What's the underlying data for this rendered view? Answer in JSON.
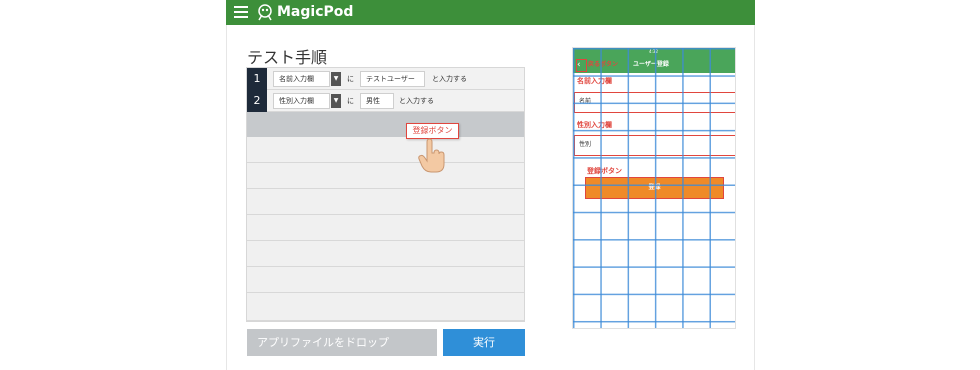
{
  "app": {
    "name": "MagicPod",
    "colors": {
      "header": "#3d8f3a",
      "accent": "#2f8fd8",
      "highlight": "#e0463e",
      "phone_button": "#ef8a28"
    }
  },
  "editor": {
    "title": "テスト手順",
    "steps": [
      {
        "num": "1",
        "element": "名前入力欄",
        "particle": "に",
        "value": "テストユーザー",
        "action": "と入力する"
      },
      {
        "num": "2",
        "element": "性別入力欄",
        "particle": "に",
        "value": "男性",
        "action": "と入力する"
      }
    ],
    "drag_label": "登録ボタン",
    "drop_file_label": "アプリファイルをドロップ",
    "run_label": "実行"
  },
  "phone": {
    "status_time": "4:32",
    "nav_highlight": "戻るボタン",
    "nav_title": "ユーザー登録",
    "name_label": "名前入力欄",
    "name_placeholder": "名前",
    "gender_label": "性別入力欄",
    "gender_placeholder": "性別",
    "button_label": "登録ボタン",
    "button_text": "登録"
  }
}
